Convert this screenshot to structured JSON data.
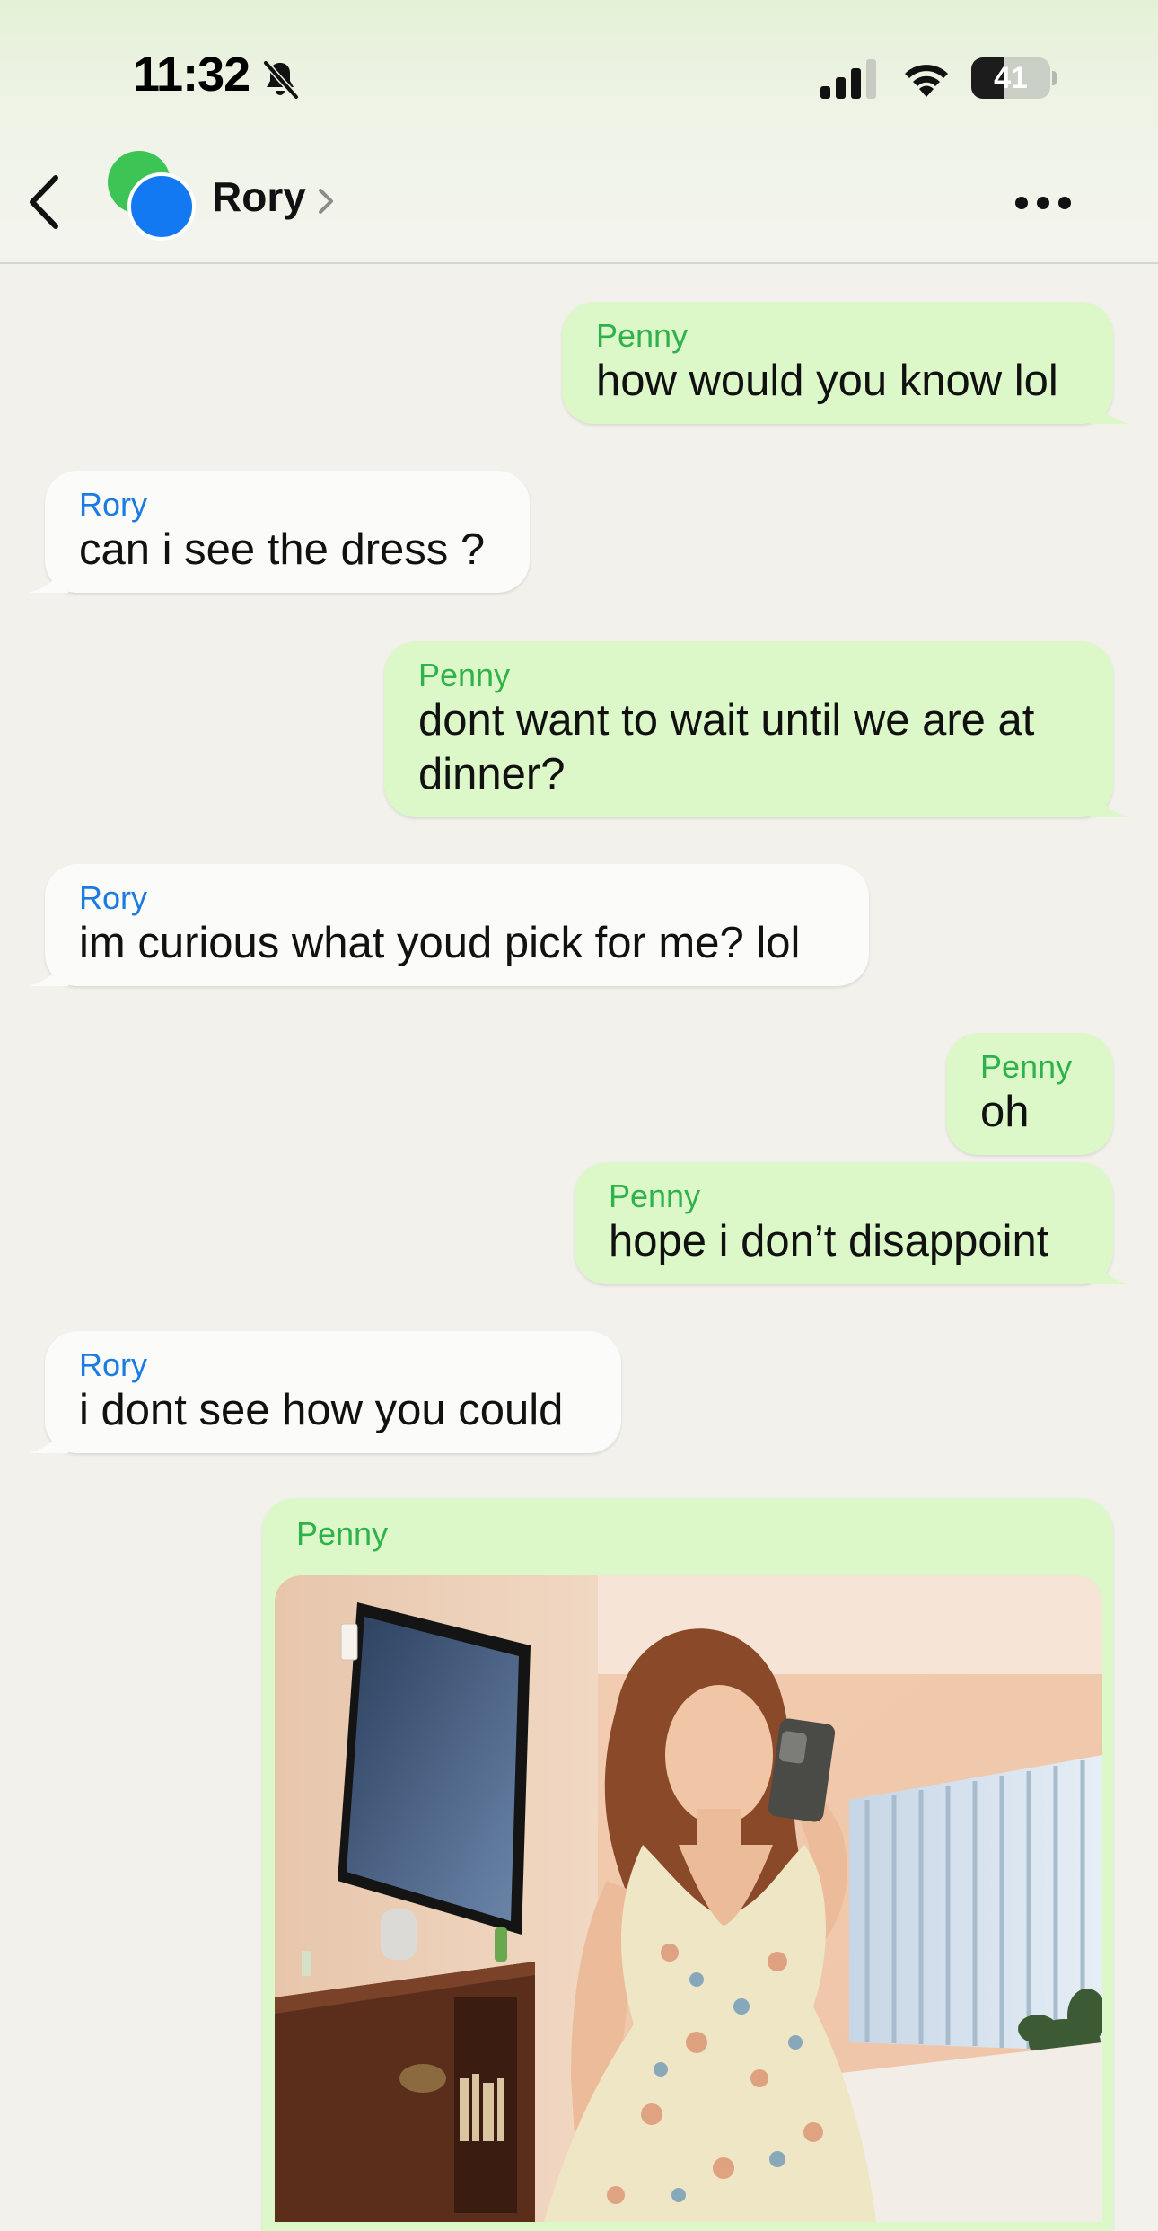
{
  "status_bar": {
    "time": "11:32",
    "battery": "41",
    "battery_fraction": 0.41,
    "icons": [
      "bell-slash-icon",
      "cellular-signal-icon",
      "wifi-icon",
      "battery-icon"
    ]
  },
  "header": {
    "contact_name": "Rory",
    "icons": [
      "back-chevron-icon",
      "group-avatar",
      "chevron-right-icon",
      "more-icon"
    ]
  },
  "colors": {
    "outgoing_bubble": "#dcf8c8",
    "incoming_bubble": "#fbfbfa",
    "outgoing_sender": "#2fb24c",
    "incoming_sender": "#1a7be0",
    "background": "#f3f1ec"
  },
  "messages": [
    {
      "direction": "out",
      "sender": "Penny",
      "lines": [
        "how would you know lol"
      ]
    },
    {
      "direction": "in",
      "sender": "Rory",
      "lines": [
        "can i see the dress ?"
      ]
    },
    {
      "direction": "out",
      "sender": "Penny",
      "lines": [
        "dont want to wait until we are at",
        "dinner?"
      ]
    },
    {
      "direction": "in",
      "sender": "Rory",
      "lines": [
        "im curious what youd pick for me? lol"
      ]
    },
    {
      "direction": "out",
      "sender": "Penny",
      "lines": [
        "oh"
      ]
    },
    {
      "direction": "out",
      "sender": "Penny",
      "lines": [
        "hope i don’t disappoint"
      ]
    },
    {
      "direction": "in",
      "sender": "Rory",
      "lines": [
        "i dont see how you could"
      ]
    },
    {
      "direction": "out",
      "sender": "Penny",
      "lines": [],
      "attachment": "photo"
    }
  ]
}
